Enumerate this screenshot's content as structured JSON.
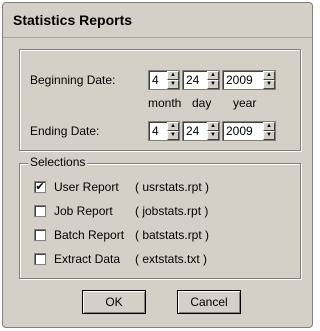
{
  "window": {
    "title": "Statistics Reports"
  },
  "dates": {
    "beginning_label": "Beginning Date:",
    "ending_label": "Ending Date:",
    "month_caption": "month",
    "day_caption": "day",
    "year_caption": "year",
    "beginning": {
      "month": "4",
      "day": "24",
      "year": "2009"
    },
    "ending": {
      "month": "4",
      "day": "24",
      "year": "2009"
    }
  },
  "selections": {
    "legend": "Selections",
    "items": [
      {
        "label": "User Report",
        "file": "( usrstats.rpt )",
        "checked": true
      },
      {
        "label": "Job Report",
        "file": "( jobstats.rpt )",
        "checked": false
      },
      {
        "label": "Batch Report",
        "file": "( batstats.rpt )",
        "checked": false
      },
      {
        "label": "Extract Data",
        "file": "( extstats.txt )",
        "checked": false
      }
    ]
  },
  "buttons": {
    "ok": "OK",
    "cancel": "Cancel"
  },
  "icons": {
    "spin_up": "arrow-up-icon",
    "spin_down": "arrow-down-icon",
    "check": "checkmark-icon"
  }
}
